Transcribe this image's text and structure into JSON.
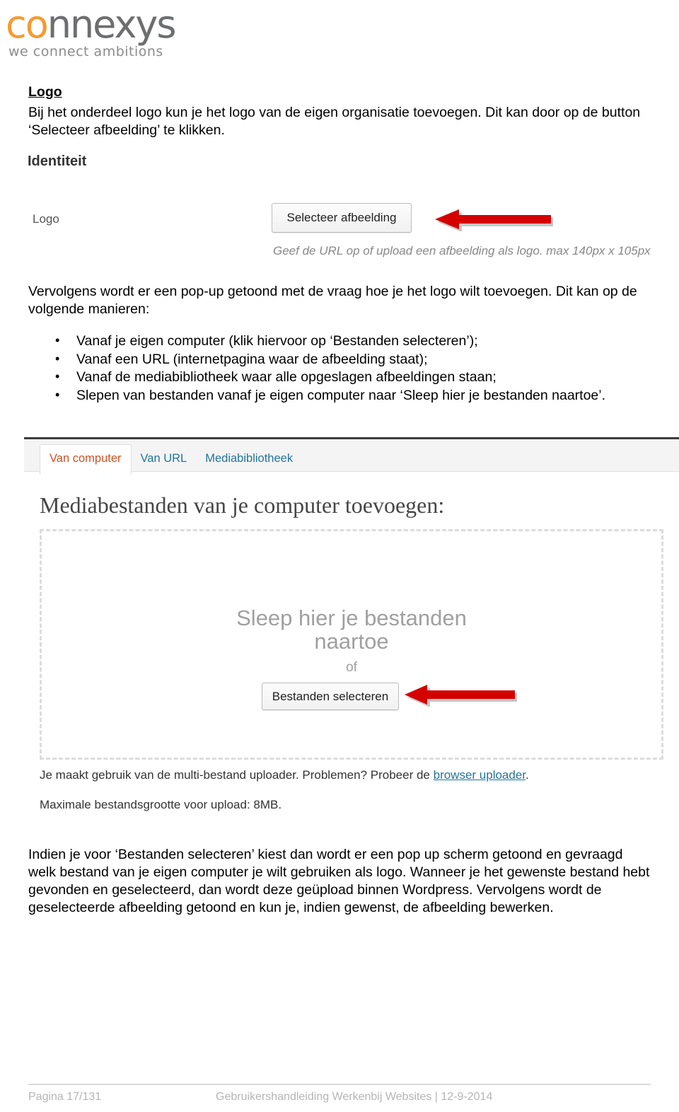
{
  "brand": {
    "name_accent": "co",
    "name_rest": "nnexys",
    "tagline": "we connect ambitions"
  },
  "doc": {
    "section_heading": "Logo",
    "intro_paragraph": "Bij het onderdeel logo kun je het logo van de eigen organisatie toevoegen. Dit kan door op de button ‘Selecteer afbeelding’ te klikken.",
    "after_shot_paragraph": "Vervolgens wordt er een pop-up getoond met de vraag hoe je het logo wilt toevoegen. Dit kan op de volgende manieren:",
    "bullets": [
      "Vanaf je eigen computer (klik hiervoor op ‘Bestanden selecteren’);",
      "Vanaf een URL (internetpagina waar de afbeelding staat);",
      "Vanaf de mediabibliotheek waar alle opgeslagen afbeeldingen staan;",
      "Slepen van bestanden vanaf je eigen computer naar ‘Sleep hier je bestanden naartoe’."
    ],
    "closing_paragraph": "Indien je voor ‘Bestanden selecteren’ kiest dan wordt er een pop up scherm getoond en gevraagd welk bestand van je eigen computer je wilt gebruiken als logo. Wanneer je het gewenste bestand hebt gevonden en geselecteerd, dan wordt deze geüpload binnen Wordpress. Vervolgens wordt de geselecteerde afbeelding getoond en kun je, indien gewenst, de afbeelding bewerken."
  },
  "identiteit_screenshot": {
    "title": "Identiteit",
    "row_label": "Logo",
    "select_button": "Selecteer afbeelding",
    "help_text": "Geef de URL op of upload een afbeelding als logo. max 140px x 105px"
  },
  "uploader_screenshot": {
    "tabs": [
      {
        "label": "Van computer",
        "active": true
      },
      {
        "label": "Van URL",
        "active": false
      },
      {
        "label": "Mediabibliotheek",
        "active": false
      }
    ],
    "heading": "Mediabestanden van je computer toevoegen:",
    "dropzone_title": "Sleep hier je bestanden naartoe",
    "dropzone_or": "of",
    "dropzone_button": "Bestanden selecteren",
    "note_prefix": "Je maakt gebruik van de multi-bestand uploader. Problemen? Probeer de ",
    "note_link": "browser uploader",
    "note_suffix": ".",
    "max_size": "Maximale bestandsgrootte voor upload: 8MB."
  },
  "footer": {
    "page": "Pagina 17/131",
    "center": "Gebruikershandleiding Werkenbij Websites | 12-9-2014"
  },
  "colors": {
    "brand_orange": "#f59b32",
    "brand_grey": "#6d6e70",
    "tab_active": "#d54e21",
    "link_blue": "#21759b",
    "arrow_red": "#d40000",
    "footer_grey": "#b5b5b5"
  }
}
